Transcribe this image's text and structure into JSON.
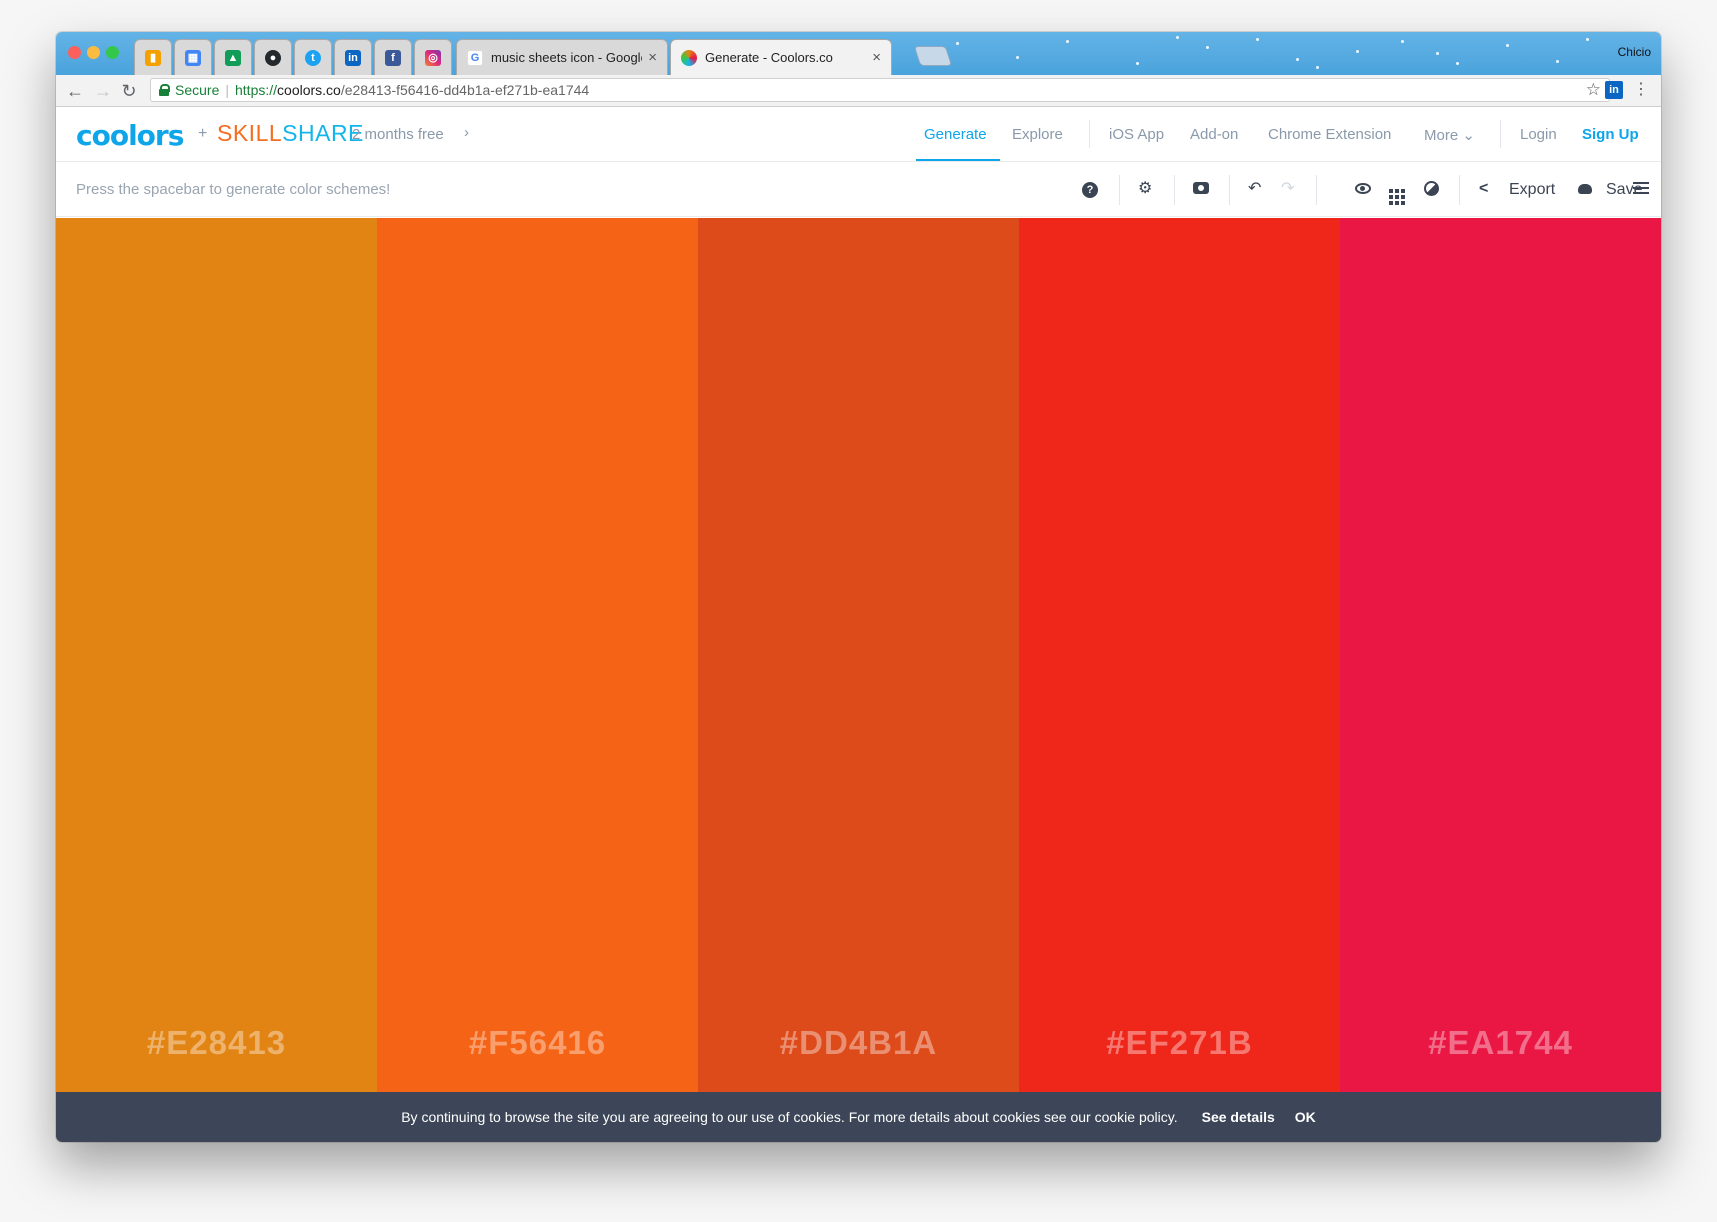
{
  "browser": {
    "profile_name": "Chicio",
    "tabs": [
      {
        "type": "pinned",
        "icon": "analytics-icon"
      },
      {
        "type": "pinned",
        "icon": "calendar-icon"
      },
      {
        "type": "pinned",
        "icon": "drive-icon"
      },
      {
        "type": "pinned",
        "icon": "github-icon"
      },
      {
        "type": "pinned",
        "icon": "twitter-icon"
      },
      {
        "type": "pinned",
        "icon": "linkedin-icon"
      },
      {
        "type": "pinned",
        "icon": "facebook-icon"
      },
      {
        "type": "pinned",
        "icon": "instagram-icon"
      },
      {
        "type": "normal",
        "icon": "google-icon",
        "title": "music sheets icon - Google Se"
      },
      {
        "type": "active",
        "icon": "coolors-icon",
        "title": "Generate - Coolors.co"
      }
    ],
    "address": {
      "secure_label": "Secure",
      "scheme": "https://",
      "host": "coolors.co",
      "path": "/e28413-f56416-dd4b1a-ef271b-ea1744"
    }
  },
  "header": {
    "logo": "coolors",
    "plus": "+",
    "partner_a": "SKILL",
    "partner_b": "SHARE",
    "promo": "2 months free",
    "promo_chevron": "›",
    "nav": {
      "generate": "Generate",
      "explore": "Explore",
      "ios": "iOS App",
      "addon": "Add-on",
      "chrome": "Chrome Extension",
      "more": "More",
      "more_caret": "⌄",
      "login": "Login",
      "signup": "Sign Up"
    }
  },
  "toolbar": {
    "hint": "Press the spacebar to generate color schemes!",
    "help_glyph": "?",
    "settings_glyph": "⚙",
    "undo_glyph": "↶",
    "redo_glyph": "↷",
    "export_glyph": "<",
    "export_label": "Export",
    "save_label": "Save"
  },
  "palette": {
    "colors": [
      {
        "hex": "#E28413",
        "label": "#E28413"
      },
      {
        "hex": "#F56416",
        "label": "#F56416"
      },
      {
        "hex": "#DD4B1A",
        "label": "#DD4B1A"
      },
      {
        "hex": "#EF271B",
        "label": "#EF271B"
      },
      {
        "hex": "#EA1744",
        "label": "#EA1744"
      }
    ]
  },
  "cookie": {
    "message": "By continuing to browse the site you are agreeing to our use of cookies. For more details about cookies see our cookie policy.",
    "details": "See details",
    "ok": "OK"
  },
  "colors": {
    "accent": "#0ea5e9",
    "skillshare_orange": "#f36e21",
    "skillshare_blue": "#13b5ea",
    "cookie_bg": "#3c4658",
    "tabstrip_bg": "#4aa3dc"
  }
}
